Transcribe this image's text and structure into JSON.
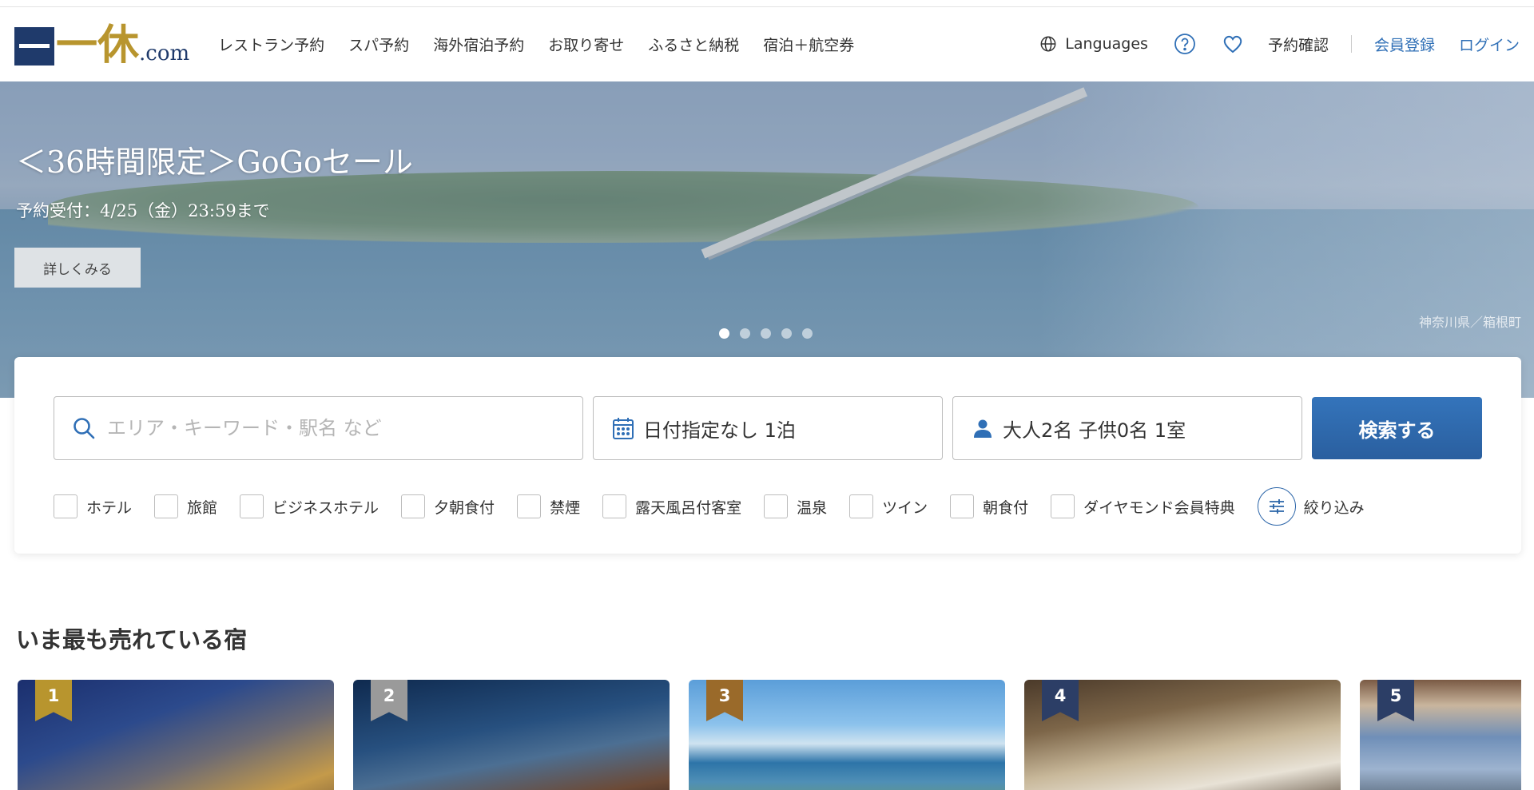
{
  "header": {
    "logo_kanji": "一休",
    "logo_suffix": ".com",
    "nav": [
      {
        "label": "レストラン予約"
      },
      {
        "label": "スパ予約"
      },
      {
        "label": "海外宿泊予約"
      },
      {
        "label": "お取り寄せ"
      },
      {
        "label": "ふるさと納税"
      },
      {
        "label": "宿泊＋航空券"
      }
    ],
    "languages_label": "Languages",
    "reservation_check": "予約確認",
    "register": "会員登録",
    "login": "ログイン"
  },
  "hero": {
    "title": "＜36時間限定＞GoGoセール",
    "subtitle": "予約受付：4/25（金）23:59まで",
    "details_button": "詳しくみる",
    "caption": "神奈川県／箱根町",
    "slide_count": 5,
    "active_slide": 1
  },
  "search": {
    "keyword_placeholder": "エリア・キーワード・駅名 など",
    "date_value": "日付指定なし 1泊",
    "guests_value": "大人2名 子供0名 1室",
    "submit_label": "検索する",
    "filters": [
      {
        "label": "ホテル"
      },
      {
        "label": "旅館"
      },
      {
        "label": "ビジネスホテル"
      },
      {
        "label": "夕朝食付"
      },
      {
        "label": "禁煙"
      },
      {
        "label": "露天風呂付客室"
      },
      {
        "label": "温泉"
      },
      {
        "label": "ツイン"
      },
      {
        "label": "朝食付"
      },
      {
        "label": "ダイヤモンド会員特典"
      }
    ],
    "refine_label": "絞り込み"
  },
  "best_sellers": {
    "title": "いま最も売れている宿",
    "cards": [
      {
        "rank": "1",
        "rank_color": "#b8952e"
      },
      {
        "rank": "2",
        "rank_color": "#9a9a9a"
      },
      {
        "rank": "3",
        "rank_color": "#9a6a2a"
      },
      {
        "rank": "4",
        "rank_color": "#2c3e66"
      },
      {
        "rank": "5",
        "rank_color": "#2c3e66"
      }
    ]
  },
  "colors": {
    "brand_navy": "#1f3a6b",
    "brand_gold": "#b8952e",
    "link_blue": "#2f6fb6",
    "search_button": "#2a64a8"
  }
}
